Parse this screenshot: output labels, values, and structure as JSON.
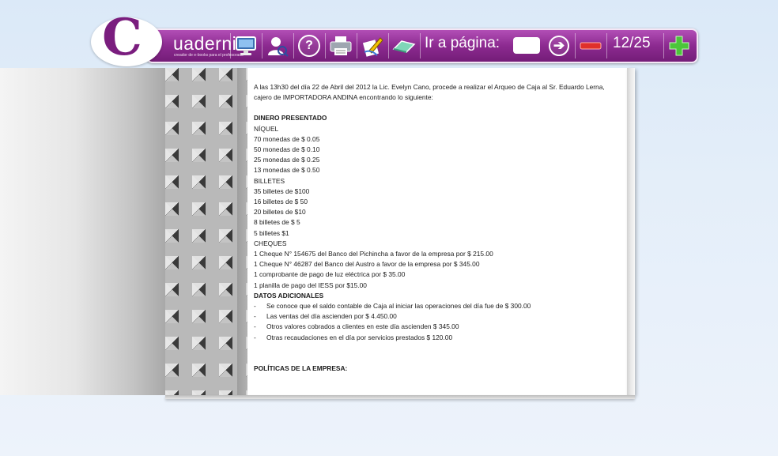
{
  "toolbar": {
    "brand_letter": "C",
    "brand": "uadernia",
    "brand_tagline": "creador de e-books para el profesorado",
    "goto_label": "Ir a página:",
    "goto_value": "",
    "current_page": "12",
    "total_pages": "25",
    "page_counter": "12/25",
    "icons": [
      "monitor-icon",
      "user-search-icon",
      "help-icon",
      "print-icon",
      "edit-icon",
      "eraser-icon",
      "go-arrow-icon",
      "zoom-out-icon",
      "zoom-in-icon"
    ]
  },
  "document": {
    "intro": "A las 13h30 del día 22 de Abril del 2012 la Lic. Evelyn Cano, procede a realizar el Arqueo de Caja al Sr. Eduardo Lerna, cajero de IMPORTADORA ANDINA encontrando lo siguiente:",
    "dinero_heading": "DINERO PRESENTADO",
    "niquel_heading": "NÍQUEL",
    "niquel": [
      "70  monedas de $ 0.05",
      "50 monedas de $ 0.10",
      "25 monedas  de $ 0.25",
      "13 monedas de $ 0.50"
    ],
    "billetes_heading": "BILLETES",
    "billetes": [
      "35 billetes de $100",
      "16 billetes de $ 50",
      "20 billetes de $10",
      "8 billetes de $ 5",
      "5 billetes $1"
    ],
    "cheques_heading": "CHEQUES",
    "cheques": [
      "1 Cheque N°  154675 del  Banco del Pichincha a favor  de la empresa   por $ 215.00",
      "1 Cheque N°  46287 del Banco del Austro a favor de la empresa por $ 345.00",
      "1 comprobante de pago de luz eléctrica por $ 35.00",
      "1 planilla de pago del IESS por $15.00"
    ],
    "datos_heading": "DATOS ADICIONALES",
    "datos": [
      "Se conoce que el saldo contable de Caja al iniciar las operaciones del día fue de $ 300.00",
      "Las ventas del día ascienden por $ 4.450.00",
      "Otros valores cobrados a clientes en este día ascienden $ 345.00",
      "Otras recaudaciones en el día por servicios prestados $ 120.00"
    ],
    "bullet": "-",
    "politicas_heading": "POLÍTICAS DE LA EMPRESA:"
  }
}
